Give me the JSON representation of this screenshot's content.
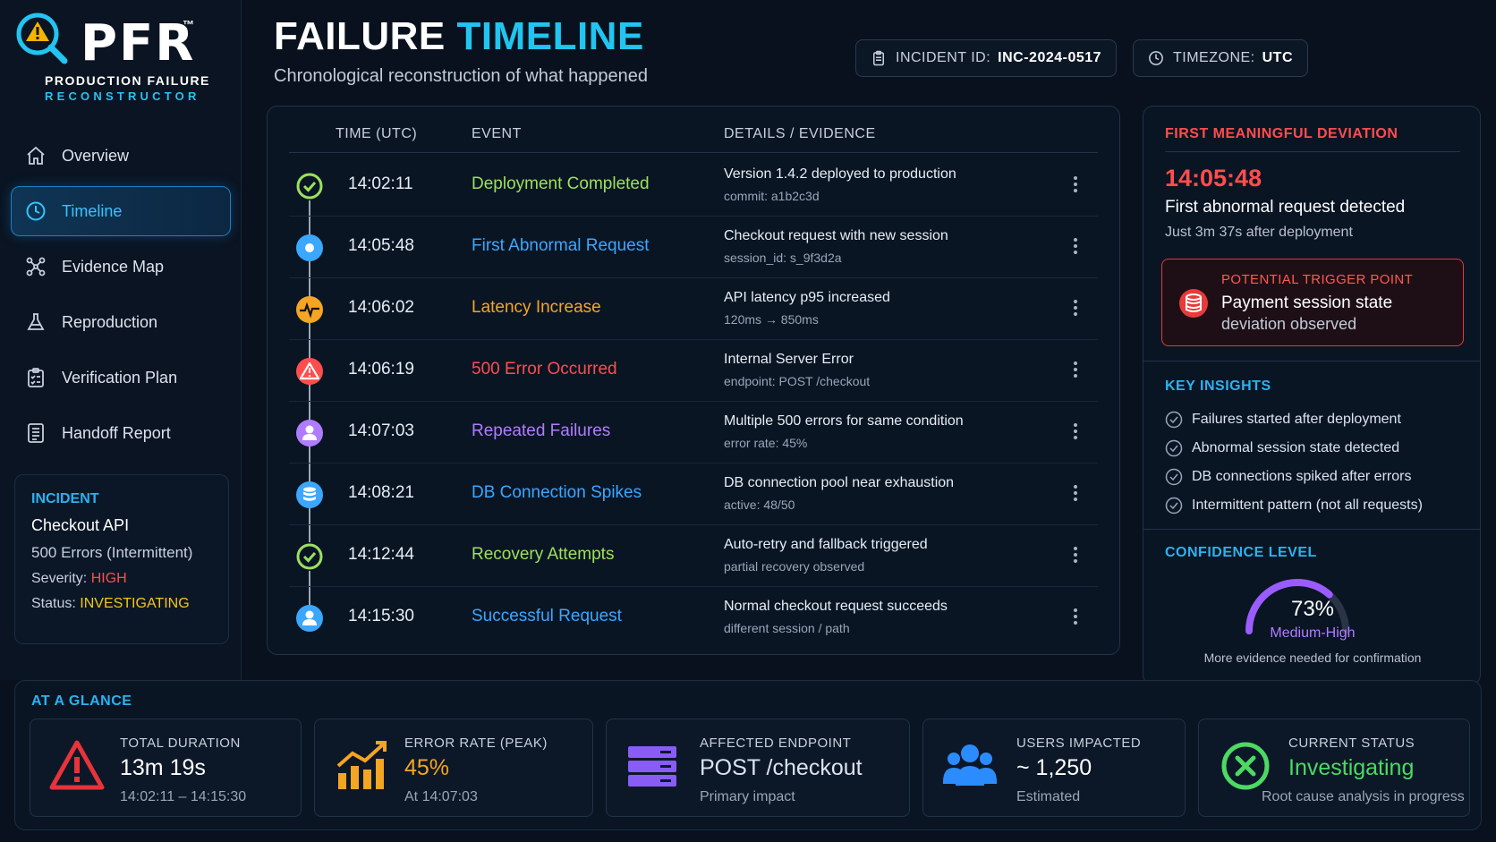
{
  "brand": {
    "name": "PFR",
    "tm": "™",
    "line1": "PRODUCTION FAILURE",
    "line2": "RECONSTRUCTOR"
  },
  "nav": [
    {
      "label": "Overview",
      "icon": "home-icon"
    },
    {
      "label": "Timeline",
      "icon": "clock-icon",
      "active": true
    },
    {
      "label": "Evidence Map",
      "icon": "network-icon"
    },
    {
      "label": "Reproduction",
      "icon": "flask-icon"
    },
    {
      "label": "Verification Plan",
      "icon": "checklist-icon"
    },
    {
      "label": "Handoff Report",
      "icon": "report-icon"
    }
  ],
  "incident": {
    "heading": "INCIDENT",
    "name": "Checkout API",
    "summary": "500 Errors (Intermittent)",
    "severity_label": "Severity:",
    "severity_value": "HIGH",
    "status_label": "Status:",
    "status_value": "INVESTIGATING"
  },
  "header": {
    "title_part1": "FAILURE",
    "title_part2": "TIMELINE",
    "subtitle": "Chronological reconstruction of what happened",
    "incident_label": "INCIDENT ID:",
    "incident_value": "INC-2024-0517",
    "timezone_label": "TIMEZONE:",
    "timezone_value": "UTC"
  },
  "timeline": {
    "columns": [
      "TIME (UTC)",
      "EVENT",
      "DETAILS / EVIDENCE"
    ],
    "rows": [
      {
        "time": "14:02:11",
        "event": "Deployment Completed",
        "detail": "Version 1.4.2 deployed to production",
        "evidence": "commit: a1b2c3d",
        "color": "#9be15d",
        "icon": "check-circle-icon"
      },
      {
        "time": "14:05:48",
        "event": "First Abnormal Request",
        "detail": "Checkout request with new session",
        "evidence": "session_id: s_9f3d2a",
        "color": "#3ba7ff",
        "icon": "user-dot-icon"
      },
      {
        "time": "14:06:02",
        "event": "Latency Increase",
        "detail": "API latency p95 increased",
        "evidence": "120ms → 850ms",
        "color": "#f5a524",
        "icon": "pulse-icon"
      },
      {
        "time": "14:06:19",
        "event": "500 Error Occurred",
        "detail": "Internal Server Error",
        "evidence": "endpoint: POST /checkout",
        "color": "#ff4d4d",
        "icon": "warning-icon"
      },
      {
        "time": "14:07:03",
        "event": "Repeated Failures",
        "detail": "Multiple 500 errors for same condition",
        "evidence": "error rate: 45%",
        "color": "#b07cff",
        "icon": "user-icon"
      },
      {
        "time": "14:08:21",
        "event": "DB Connection Spikes",
        "detail": "DB connection pool near exhaustion",
        "evidence": "active: 48/50",
        "color": "#3ba7ff",
        "icon": "database-icon"
      },
      {
        "time": "14:12:44",
        "event": "Recovery Attempts",
        "detail": "Auto-retry and fallback triggered",
        "evidence": "partial recovery observed",
        "color": "#9be15d",
        "icon": "check-circle-icon"
      },
      {
        "time": "14:15:30",
        "event": "Successful Request",
        "detail": "Normal checkout request succeeds",
        "evidence": "different session / path",
        "color": "#3ba7ff",
        "icon": "user-icon"
      }
    ]
  },
  "deviation": {
    "heading": "FIRST MEANINGFUL DEVIATION",
    "time": "14:05:48",
    "description": "First abnormal request detected",
    "note": "Just 3m 37s after deployment",
    "trigger_heading": "POTENTIAL TRIGGER POINT",
    "trigger_line1": "Payment session state",
    "trigger_line2": "deviation observed"
  },
  "insights": {
    "heading": "KEY INSIGHTS",
    "items": [
      "Failures started after deployment",
      "Abnormal session state detected",
      "DB connections spiked after errors",
      "Intermittent pattern (not all requests)"
    ]
  },
  "confidence": {
    "heading": "CONFIDENCE LEVEL",
    "value": "73%",
    "fraction": 0.73,
    "label": "Medium-High",
    "note": "More evidence needed for confirmation"
  },
  "glance": {
    "heading": "AT A GLANCE",
    "cards": [
      {
        "label": "TOTAL DURATION",
        "value": "13m 19s",
        "sub": "14:02:11 – 14:15:30",
        "color": "#ffffff",
        "icon": "alert-triangle-icon"
      },
      {
        "label": "ERROR RATE",
        "label_suffix": "(PEAK)",
        "value": "45%",
        "sub": "At 14:07:03",
        "color": "#f5a524",
        "icon": "bar-chart-up-icon"
      },
      {
        "label": "AFFECTED ENDPOINT",
        "value": "POST /checkout",
        "sub": "Primary impact",
        "color": "#dbe3ee",
        "icon": "server-icon"
      },
      {
        "label": "USERS IMPACTED",
        "value": "~ 1,250",
        "sub": "Estimated",
        "color": "#ffffff",
        "icon": "users-icon"
      },
      {
        "label": "CURRENT STATUS",
        "value": "Investigating",
        "sub": "Root cause analysis in progress",
        "color": "#4cd964",
        "icon": "x-circle-icon"
      }
    ]
  }
}
